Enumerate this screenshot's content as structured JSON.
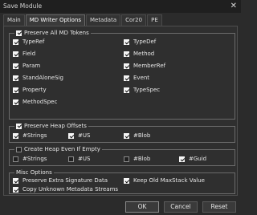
{
  "window": {
    "title": "Save Module",
    "close_glyph": "✕"
  },
  "tabs": [
    "Main",
    "MD Writer Options",
    "Metadata",
    "Cor20",
    "PE"
  ],
  "active_tab": 1,
  "groups": {
    "tokens": {
      "title": "Preserve All MD Tokens",
      "checked": true,
      "options": [
        {
          "label": "TypeRef",
          "checked": true
        },
        {
          "label": "TypeDef",
          "checked": true
        },
        {
          "label": "Field",
          "checked": true
        },
        {
          "label": "Method",
          "checked": true
        },
        {
          "label": "Param",
          "checked": true
        },
        {
          "label": "MemberRef",
          "checked": true
        },
        {
          "label": "StandAloneSig",
          "checked": true
        },
        {
          "label": "Event",
          "checked": true
        },
        {
          "label": "Property",
          "checked": true
        },
        {
          "label": "TypeSpec",
          "checked": true
        },
        {
          "label": "MethodSpec",
          "checked": true
        }
      ]
    },
    "heap_offsets": {
      "title": "Preserve Heap Offsets",
      "checked": true,
      "options": [
        {
          "label": "#Strings",
          "checked": true
        },
        {
          "label": "#US",
          "checked": true
        },
        {
          "label": "#Blob",
          "checked": true
        }
      ]
    },
    "create_heap": {
      "title": "Create Heap Even If Empty",
      "checked": false,
      "options": [
        {
          "label": "#Strings",
          "checked": false
        },
        {
          "label": "#US",
          "checked": false
        },
        {
          "label": "#Blob",
          "checked": false
        },
        {
          "label": "#Guid",
          "checked": true
        }
      ]
    },
    "misc": {
      "title": "Misc Options",
      "options": [
        {
          "label": "Preserve Extra Signature Data",
          "checked": true
        },
        {
          "label": "Keep Old MaxStack Value",
          "checked": true
        },
        {
          "label": "Copy Unknown Metadata Streams",
          "checked": true
        }
      ]
    }
  },
  "buttons": {
    "ok": "OK",
    "cancel": "Cancel",
    "reset": "Reset"
  }
}
